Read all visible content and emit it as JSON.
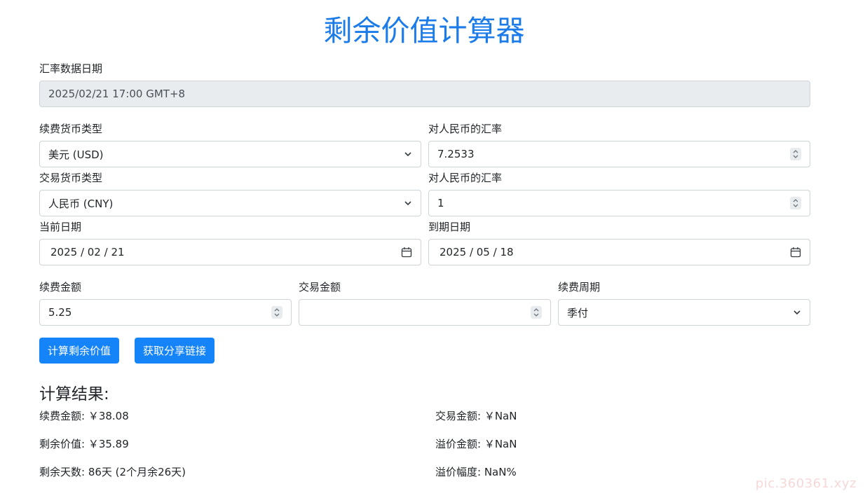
{
  "title": "剩余价值计算器",
  "rate_date": {
    "label": "汇率数据日期",
    "value": "2025/02/21 17:00 GMT+8"
  },
  "renew_currency": {
    "label": "续费货币类型",
    "value": "美元 (USD)"
  },
  "renew_rate": {
    "label": "对人民币的汇率",
    "value": "7.2533"
  },
  "trade_currency": {
    "label": "交易货币类型",
    "value": "人民币 (CNY)"
  },
  "trade_rate": {
    "label": "对人民币的汇率",
    "value": "1"
  },
  "current_date": {
    "label": "当前日期",
    "value": "2025 / 02 / 21"
  },
  "expiry_date": {
    "label": "到期日期",
    "value": "2025 / 05 / 18"
  },
  "renew_amount": {
    "label": "续费金额",
    "value": "5.25"
  },
  "trade_amount": {
    "label": "交易金额",
    "value": ""
  },
  "renew_period": {
    "label": "续费周期",
    "value": "季付"
  },
  "buttons": {
    "calculate": "计算剩余价值",
    "share": "获取分享链接"
  },
  "results": {
    "heading": "计算结果:",
    "renew_amount": "续费金额: ￥38.08",
    "trade_amount": "交易金额: ￥NaN",
    "remaining_value": "剩余价值: ￥35.89",
    "premium_amount": "溢价金额: ￥NaN",
    "remaining_days": "剩余天数: 86天 (2个月余26天)",
    "premium_rate": "溢价幅度: NaN%"
  },
  "watermark": "pic.360361.xyz",
  "icons": {
    "select": "chevron-down-icon",
    "spin": "spinner-arrows-icon",
    "date": "calendar-icon"
  }
}
